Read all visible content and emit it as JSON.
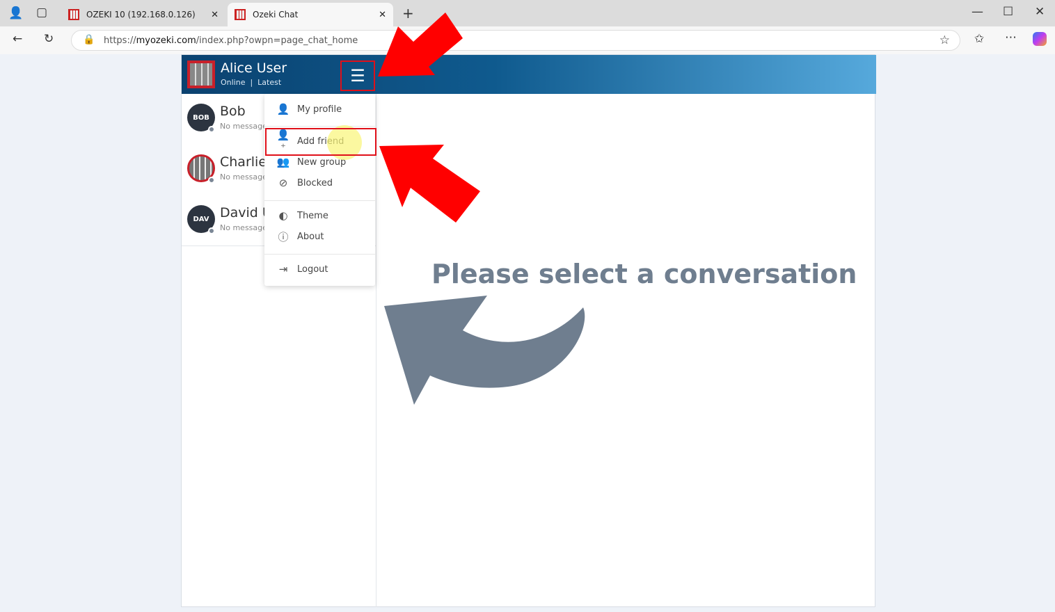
{
  "browser": {
    "tabs": [
      {
        "title": "OZEKI 10 (192.168.0.126)"
      },
      {
        "title": "Ozeki Chat"
      }
    ],
    "url_prefix": "https://",
    "url_domain": "myozeki.com",
    "url_path": "/index.php?owpn=page_chat_home"
  },
  "header": {
    "user_name": "Alice User",
    "status": "Online  |  Latest"
  },
  "contacts": [
    {
      "name": "Bob",
      "initials": "BOB",
      "last": "No message"
    },
    {
      "name": "Charlie",
      "initials": "",
      "last": "No message"
    },
    {
      "name": "David U",
      "initials": "DAV",
      "last": "No message"
    }
  ],
  "menu": {
    "items": [
      {
        "label": "My profile",
        "icon": "user-icon"
      },
      {
        "label": "Add friend",
        "icon": "user-plus-icon"
      },
      {
        "label": "New group",
        "icon": "users-plus-icon"
      },
      {
        "label": "Blocked",
        "icon": "blocked-icon"
      },
      {
        "label": "Theme",
        "icon": "theme-icon"
      },
      {
        "label": "About",
        "icon": "help-icon"
      },
      {
        "label": "Logout",
        "icon": "logout-icon"
      }
    ]
  },
  "main": {
    "prompt": "Please select a conversation"
  },
  "colors": {
    "accent": "#0f5a8e",
    "highlight": "#e0101a",
    "arrow_gray": "#6f7e8f"
  }
}
